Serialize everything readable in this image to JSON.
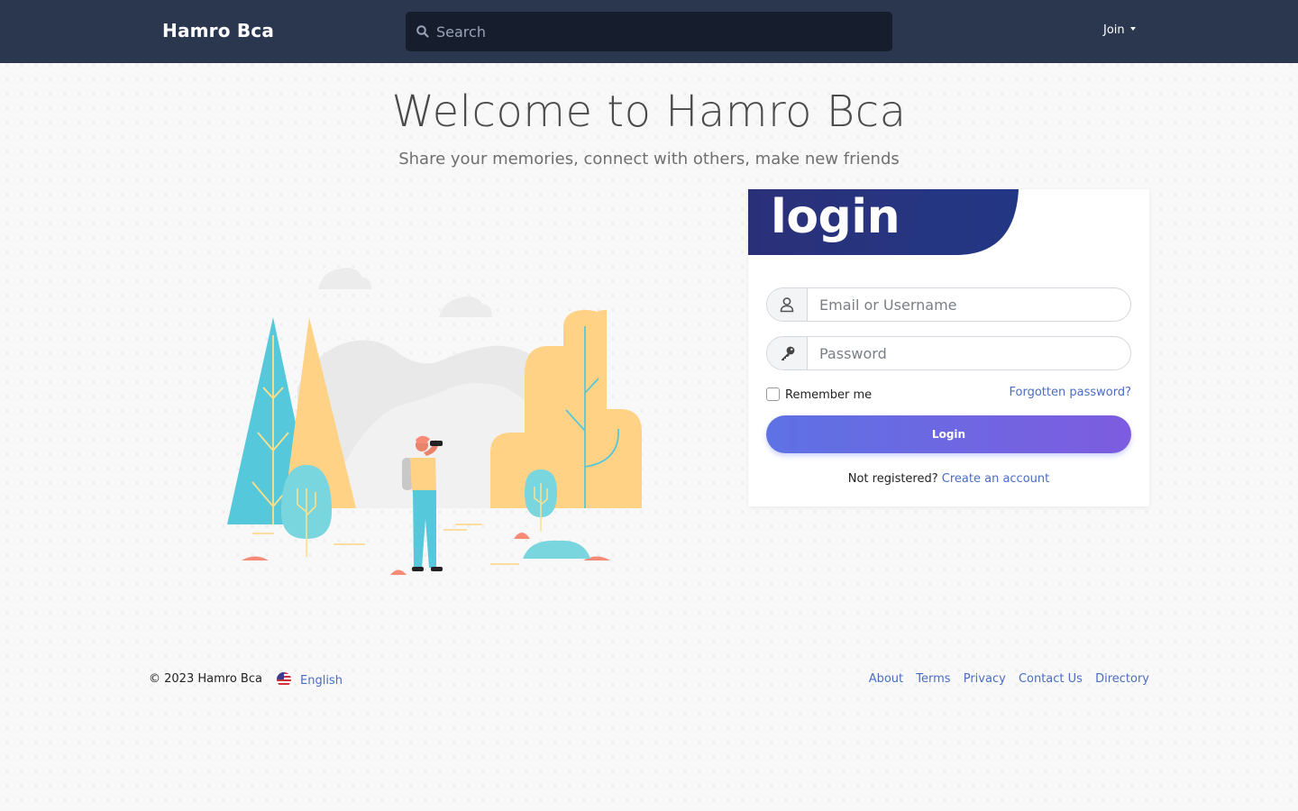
{
  "navbar": {
    "brand": "Hamro Bca",
    "search_placeholder": "Search",
    "join_label": "Join"
  },
  "hero": {
    "title": "Welcome to Hamro Bca",
    "subtitle": "Share your memories, connect with others, make new friends"
  },
  "login_card": {
    "title": "login",
    "username_placeholder": "Email or Username",
    "password_placeholder": "Password",
    "remember_label": "Remember me",
    "forgot_label": "Forgotten password?",
    "submit_label": "Login",
    "register_prompt": "Not registered?",
    "register_link": "Create an account"
  },
  "footer": {
    "copyright": "© 2023 Hamro Bca",
    "language": "English",
    "links": [
      "About",
      "Terms",
      "Privacy",
      "Contact Us",
      "Directory"
    ]
  },
  "colors": {
    "navbar_bg": "#2b364f",
    "search_bg": "#161d2c",
    "banner_dark": "#2a3078",
    "banner_light": "#253886",
    "button_start": "#5e72e4",
    "button_end": "#7d5ce0",
    "link": "#4a6dc3"
  },
  "icons": {
    "search": "search-icon",
    "user": "user-icon",
    "password": "key-icon",
    "language": "us-flag-icon",
    "dropdown": "caret-down-icon"
  }
}
